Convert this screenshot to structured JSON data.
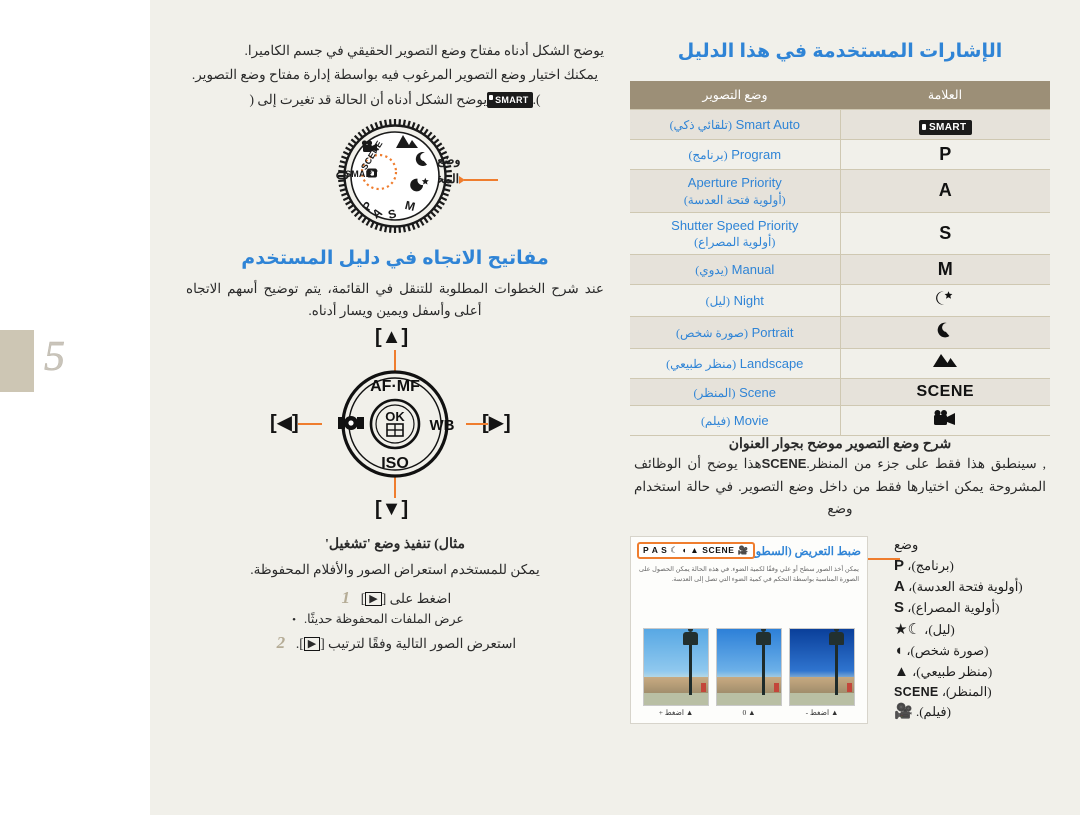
{
  "page": {
    "number": "5"
  },
  "left_column": {
    "intro": {
      "line1": "يوضح الشكل أدناه مفتاح وضع التصوير الحقيقي في جسم الكاميرا.",
      "line2": "يمكنك اختيار وضع التصوير المرغوب فيه بواسطة إدارة مفتاح وضع التصوير.",
      "line3_prefix": "يوضح الشكل أدناه أن الحالة قد تغيرت إلى (",
      "line3_badge": "SMART",
      "line3_suffix": ")."
    },
    "dial": {
      "callout_line1": "وضع التصوير",
      "callout_line2": "المختار حاليًا",
      "selected_mode": "SMART",
      "positions": [
        "SCENE",
        "Movie",
        "Landscape",
        "Portrait",
        "Night",
        "M",
        "S",
        "A",
        "P",
        "Smart Auto"
      ]
    },
    "direction_section": {
      "heading": "مفاتيح الاتجاه في دليل المستخدم",
      "body": "عند شرح الخطوات المطلوبة للتنقل في القائمة، يتم توضيح أسهم الاتجاه أعلى وأسفل ويمين ويسار أدناه.",
      "keys": {
        "up": "[▲]",
        "down": "[▼]",
        "left": "[◀]",
        "right": "[▶]",
        "top_label": "AF·MF",
        "bottom_label": "ISO",
        "right_label": "WB",
        "left_label": "metering-icon",
        "center_label": "OK"
      }
    },
    "example": {
      "heading": "مثال) تنفيذ وضع 'تشغيل'",
      "intro": "يمكن للمستخدم استعراض الصور والأفلام المحفوظة.",
      "steps": [
        {
          "num": "1",
          "text_before": "اضغط على [",
          "key": "▶",
          "text_after": "]"
        },
        {
          "num": "2",
          "text_before": "استعرض الصور التالية وفقًا لترتيب [",
          "key": "▶",
          "text_after": "]."
        }
      ],
      "bullet": "عرض الملفات المحفوظة حديثًا."
    }
  },
  "right_column": {
    "heading": "الإشارات المستخدمة في هذا الدليل",
    "table": {
      "headers": {
        "mode": "وضع التصوير",
        "mark": "العلامة"
      },
      "rows": [
        {
          "mode_en": "Smart Auto",
          "mode_ar": "(تلقائي ذكي)",
          "mark": "SMART",
          "mark_type": "badge"
        },
        {
          "mode_en": "Program",
          "mode_ar": "(برنامج)",
          "mark": "P",
          "mark_type": "text"
        },
        {
          "mode_en": "Aperture Priority",
          "mode_ar": "(أولوية فتحة العدسة)",
          "mark": "A",
          "mark_type": "text"
        },
        {
          "mode_en": "Shutter Speed Priority",
          "mode_ar": "(أولوية المصراع)",
          "mark": "S",
          "mark_type": "text"
        },
        {
          "mode_en": "Manual",
          "mode_ar": "(يدوي)",
          "mark": "M",
          "mark_type": "text"
        },
        {
          "mode_en": "Night",
          "mode_ar": "(ليل)",
          "mark": "☾★",
          "mark_type": "glyph"
        },
        {
          "mode_en": "Portrait",
          "mode_ar": "(صورة شخص)",
          "mark": "◖",
          "mark_type": "glyph"
        },
        {
          "mode_en": "Landscape",
          "mode_ar": "(منظر طبيعي)",
          "mark": "▲",
          "mark_type": "glyph"
        },
        {
          "mode_en": "Scene",
          "mode_ar": "(المنظر)",
          "mark": "SCENE",
          "mark_type": "scene"
        },
        {
          "mode_en": "Movie",
          "mode_ar": "(فيلم)",
          "mark": "🎥",
          "mark_type": "glyph"
        }
      ]
    },
    "caption": {
      "heading": "شرح وضع التصوير موضح بجوار العنوان",
      "body_part1": "هذا يوضح أن الوظائف المشروحة يمكن اختيارها فقط من داخل وضع التصوير. في حالة استخدام وضع ",
      "body_scene": "SCENE",
      "body_part2": ", سينطبق هذا فقط على جزء من المنظر."
    },
    "callout": {
      "lead": "وضع",
      "items": [
        {
          "sym": "P",
          "ar": "(برنامج)،"
        },
        {
          "sym": "A",
          "ar": "(أولوية فتحة العدسة)،"
        },
        {
          "sym": "S",
          "ar": "(أولوية المصراع)،"
        },
        {
          "sym": "☾★",
          "ar": "(ليل)،"
        },
        {
          "sym": "◖",
          "ar": "(صورة شخص)،"
        },
        {
          "sym": "▲",
          "ar": "(منظر طبيعي)،"
        },
        {
          "sym": "SCENE",
          "ar": "(المنظر)،"
        },
        {
          "sym": "🎥",
          "ar": "(فيلم)."
        }
      ]
    },
    "screenshot": {
      "title": "ضبط التعريض (السطوع)",
      "icon_strip": "P A S ☾ ◖ ▲ SCENE 🎥",
      "body": "يمكن أخذ الصور سطح أو علي وفقًا لكمية الضوء. في هذه الحالة يمكن الحصول على الصورة المناسبة بواسطة التحكم في كمية الضوء التي تصل إلى العدسة.",
      "thumbs": [
        {
          "caption": "▲ اضغط +",
          "variant": "light"
        },
        {
          "caption": "▲ 0",
          "variant": "mid"
        },
        {
          "caption": "▲ اضغط -",
          "variant": "dark"
        }
      ]
    }
  },
  "colors": {
    "accent_blue": "#2f84d6",
    "accent_orange": "#ef7d2e",
    "table_header": "#9c8f77",
    "row_alt": "#e6e2da",
    "page_bg": "#f1f0ea",
    "tab_tan": "#cdc6b4"
  }
}
